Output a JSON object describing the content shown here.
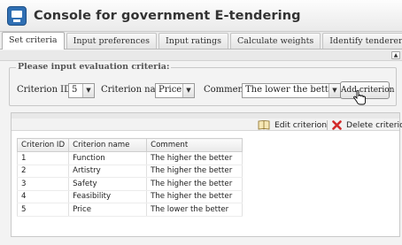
{
  "window": {
    "title": "Console for government E-tendering",
    "icon": "console-app-icon"
  },
  "tabs": [
    {
      "label": "Set criteria",
      "active": true
    },
    {
      "label": "Input preferences",
      "active": false
    },
    {
      "label": "Input ratings",
      "active": false
    },
    {
      "label": "Calculate weights",
      "active": false
    },
    {
      "label": "Identify tenderers",
      "active": false
    }
  ],
  "criteria_form": {
    "legend": "Please input evaluation criteria:",
    "criterion_id_label": "Criterion ID:",
    "criterion_id_value": "5",
    "criterion_name_label": "Criterion name:",
    "criterion_name_value": "Price",
    "comment_label": "Comment:",
    "comment_value": "The lower the bette",
    "add_button": "Add criterion"
  },
  "grid_toolbar": {
    "edit": "Edit criterion",
    "edit_icon": "book-icon",
    "delete": "Delete criterion",
    "delete_icon": "red-x-icon"
  },
  "table": {
    "columns": [
      "Criterion ID",
      "Criterion name",
      "Comment"
    ],
    "rows": [
      [
        "1",
        "Function",
        "The higher the better"
      ],
      [
        "2",
        "Artistry",
        "The higher the better"
      ],
      [
        "3",
        "Safety",
        "The higher the better"
      ],
      [
        "4",
        "Feasibility",
        "The higher the better"
      ],
      [
        "5",
        "Price",
        "The lower the better"
      ]
    ]
  },
  "colors": {
    "delete_icon": "#d22a2a",
    "app_icon": "#2f6fb3"
  }
}
